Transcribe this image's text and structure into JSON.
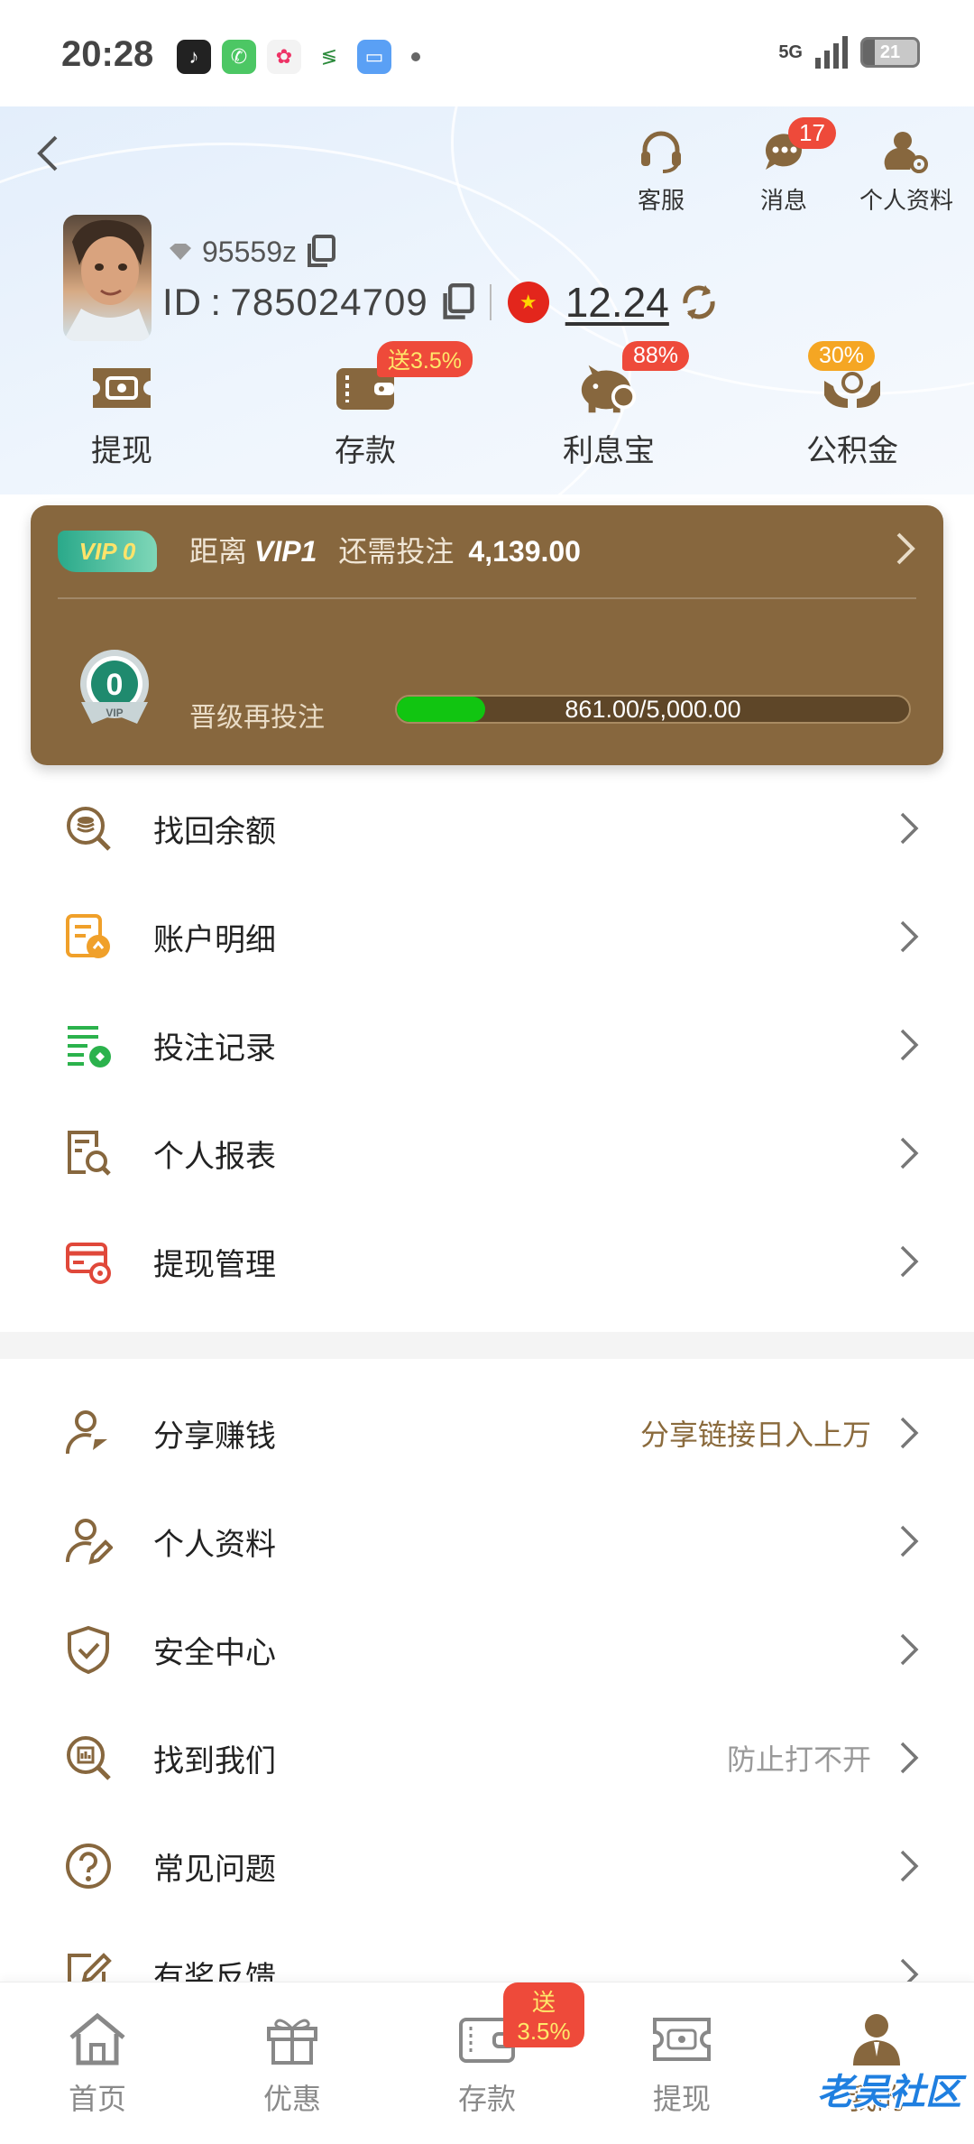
{
  "status_bar": {
    "time": "20:28",
    "network": "5G",
    "battery": "21"
  },
  "header": {
    "top_actions": [
      {
        "label": "客服",
        "icon": "headset-icon"
      },
      {
        "label": "消息",
        "icon": "chat-bubble-icon",
        "badge": "17"
      },
      {
        "label": "个人资料",
        "icon": "user-gear-icon"
      }
    ],
    "username": "95559z",
    "id_text": "ID : 785024709",
    "balance": "12.24",
    "quick_actions": [
      {
        "label": "提现",
        "icon": "ticket-cash-icon"
      },
      {
        "label": "存款",
        "icon": "wallet-icon",
        "badge": "送3.5%"
      },
      {
        "label": "利息宝",
        "icon": "piggy-bank-icon",
        "badge": "88%"
      },
      {
        "label": "公积金",
        "icon": "hands-coin-icon",
        "badge": "30%"
      }
    ]
  },
  "vip": {
    "current_level": "VIP 0",
    "prefix": "距离",
    "next_level": "VIP1",
    "need_text": "还需投注",
    "need_amount": "4,139.00",
    "medal_number": "0",
    "medal_caption": "VIP",
    "upgrade_label": "晋级再投注",
    "progress_text": "861.00/5,000.00",
    "progress_fraction": 0.1722
  },
  "menu_group_1": [
    {
      "label": "找回余额",
      "icon": "coin-search-icon"
    },
    {
      "label": "账户明细",
      "icon": "account-detail-icon"
    },
    {
      "label": "投注记录",
      "icon": "bet-record-icon"
    },
    {
      "label": "个人报表",
      "icon": "report-search-icon"
    },
    {
      "label": "提现管理",
      "icon": "card-gear-icon"
    }
  ],
  "menu_group_2": [
    {
      "label": "分享赚钱",
      "icon": "user-share-icon",
      "extra": "分享链接日入上万"
    },
    {
      "label": "个人资料",
      "icon": "user-edit-icon"
    },
    {
      "label": "安全中心",
      "icon": "shield-check-icon"
    },
    {
      "label": "找到我们",
      "icon": "find-us-icon",
      "extra": "防止打不开"
    },
    {
      "label": "常见问题",
      "icon": "question-icon"
    },
    {
      "label": "有奖反馈",
      "icon": "feedback-edit-icon"
    }
  ],
  "bottom_nav": [
    {
      "label": "首页",
      "icon": "home-icon"
    },
    {
      "label": "优惠",
      "icon": "gift-icon"
    },
    {
      "label": "存款",
      "icon": "wallet-icon",
      "badge": "送3.5%"
    },
    {
      "label": "提现",
      "icon": "ticket-cash-icon"
    },
    {
      "label": "我的",
      "icon": "person-icon"
    }
  ],
  "colors": {
    "brand": "#87673e",
    "badge_red": "#ee4a3a",
    "badge_orange": "#f5a623",
    "progress_green": "#11c511",
    "extra_text_brand": "#8a6a3c",
    "extra_text_gray": "#999999"
  },
  "watermark": "老吴社区"
}
